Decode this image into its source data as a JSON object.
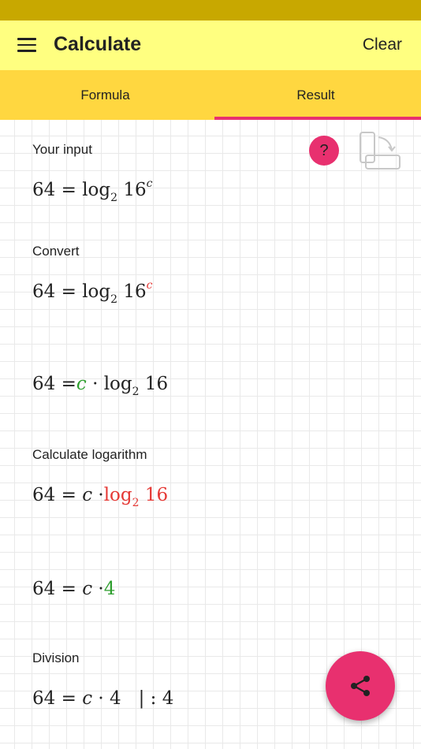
{
  "app_bar": {
    "title": "Calculate",
    "clear_label": "Clear"
  },
  "tabs": [
    {
      "label": "Formula"
    },
    {
      "label": "Result"
    }
  ],
  "active_tab": "Result",
  "colors": {
    "accent": "#e8306f",
    "app_bar": "#ffff80",
    "tab_bar": "#ffd740",
    "status_bar": "#c8a800",
    "highlight_red": "#e53935",
    "highlight_green": "#2e9e2e"
  },
  "help": {
    "label": "?"
  },
  "icons": {
    "menu": "hamburger-icon",
    "rotate": "screen-rotate-icon",
    "share": "share-icon"
  },
  "steps": {
    "input": {
      "label": "Your input",
      "lhs": "64",
      "op": " = ",
      "fn": "log",
      "base": "2",
      "arg": " 16",
      "exp": "c"
    },
    "convert": {
      "label": "Convert",
      "lhs": "64",
      "op": " = ",
      "fn": "log",
      "base": "2",
      "arg": " 16",
      "exp": "c"
    },
    "convert_result": {
      "lhs": "64",
      "op": " =",
      "var": "c",
      "dot": " · ",
      "fn": "log",
      "base": "2",
      "arg": " 16"
    },
    "logarithm": {
      "label": "Calculate logarithm",
      "lhs": "64",
      "op": " = ",
      "var": "c",
      "dot": " ·",
      "fn": "log",
      "base": "2",
      "arg": " 16"
    },
    "logarithm_result": {
      "lhs": "64",
      "op": " = ",
      "var": "c",
      "dot": " ·",
      "value": "4"
    },
    "division": {
      "label": "Division",
      "lhs": "64",
      "op": " = ",
      "var": "c",
      "dot": " · ",
      "value": "4",
      "operation": "   | : 4"
    }
  }
}
